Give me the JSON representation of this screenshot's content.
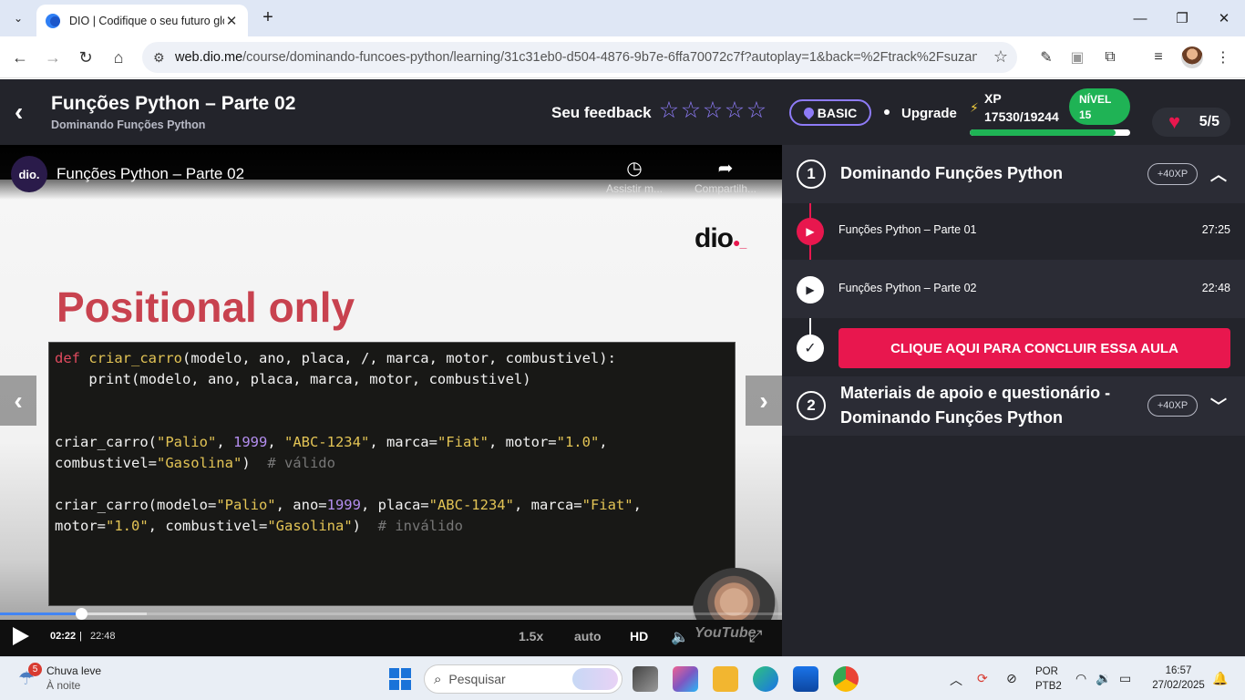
{
  "browser": {
    "tab_title": "DIO | Codifique o seu futuro glo",
    "url_host": "web.dio.me",
    "url_path": "/course/dominando-funcoes-python/learning/31c31eb0-d504-4876-9b7e-6ffa70072c7f?autoplay=1&back=%2Ftrack%2Fsuzano-..."
  },
  "header": {
    "title": "Funções Python – Parte 02",
    "subtitle": "Dominando Funções Python",
    "feedback_label": "Seu feedback",
    "plan_label": "BASIC",
    "upgrade_label": "Upgrade",
    "xp_label": "XP",
    "xp_value": "17530/19244",
    "xp_progress": 0.91,
    "level_label": "NÍVEL",
    "level_value": "15",
    "lives": "5/5"
  },
  "video": {
    "title": "Funções Python – Parte 02",
    "channel_avatar": "dio.",
    "watch_later": "Assistir m...",
    "share": "Compartilh...",
    "slide_logo": "dio",
    "slide_heading": "Positional only",
    "current_time": "02:22",
    "separator": "|",
    "duration": "22:48",
    "speed": "1.5x",
    "quality_auto": "auto",
    "quality_hd": "HD",
    "played_fraction": 0.104,
    "youtube_logo": "YouTube"
  },
  "code": {
    "l1_kw": "def",
    "l1_fn": "criar_carro",
    "l1_rest": "(modelo, ano, placa, /, marca, motor, combustivel):",
    "l2": "    print(modelo, ano, placa, marca, motor, combustivel)",
    "l5_a": "criar_carro(",
    "l5_s1": "\"Palio\"",
    "l5_b": ", ",
    "l5_n1": "1999",
    "l5_c": ", ",
    "l5_s2": "\"ABC-1234\"",
    "l5_d": ", marca=",
    "l5_s3": "\"Fiat\"",
    "l5_e": ", motor=",
    "l5_s4": "\"1.0\"",
    "l5_f": ",",
    "l6_a": "combustivel=",
    "l6_s1": "\"Gasolina\"",
    "l6_b": ")  ",
    "l6_com": "# válido",
    "l8_a": "criar_carro(modelo=",
    "l8_s1": "\"Palio\"",
    "l8_b": ", ano=",
    "l8_n1": "1999",
    "l8_c": ", placa=",
    "l8_s2": "\"ABC-1234\"",
    "l8_d": ", marca=",
    "l8_s3": "\"Fiat\"",
    "l8_e": ",",
    "l9_a": "motor=",
    "l9_s1": "\"1.0\"",
    "l9_b": ", combustivel=",
    "l9_s2": "\"Gasolina\"",
    "l9_c": ")  ",
    "l9_com": "# inválido"
  },
  "sidebar": {
    "module1": {
      "number": "1",
      "title": "Dominando Funções Python",
      "xp": "+40XP",
      "lessons": [
        {
          "title": "Funções Python – Parte 01",
          "duration": "27:25"
        },
        {
          "title": "Funções Python – Parte 02",
          "duration": "22:48"
        }
      ],
      "conclude_label": "CLIQUE AQUI PARA CONCLUIR ESSA AULA"
    },
    "module2": {
      "number": "2",
      "title_line1": "Materiais de apoio e questionário -",
      "title_line2": "Dominando Funções Python",
      "xp": "+40XP"
    }
  },
  "taskbar": {
    "weather_badge": "5",
    "weather_line1": "Chuva leve",
    "weather_line2": "À noite",
    "search_placeholder": "Pesquisar",
    "lang_line1": "POR",
    "lang_line2": "PTB2",
    "time": "16:57",
    "date": "27/02/2025"
  },
  "colors": {
    "accent_pink": "#e8174e",
    "accent_purple": "#8e7bf7",
    "level_green": "#1fb355",
    "header_bg": "#23242b"
  }
}
